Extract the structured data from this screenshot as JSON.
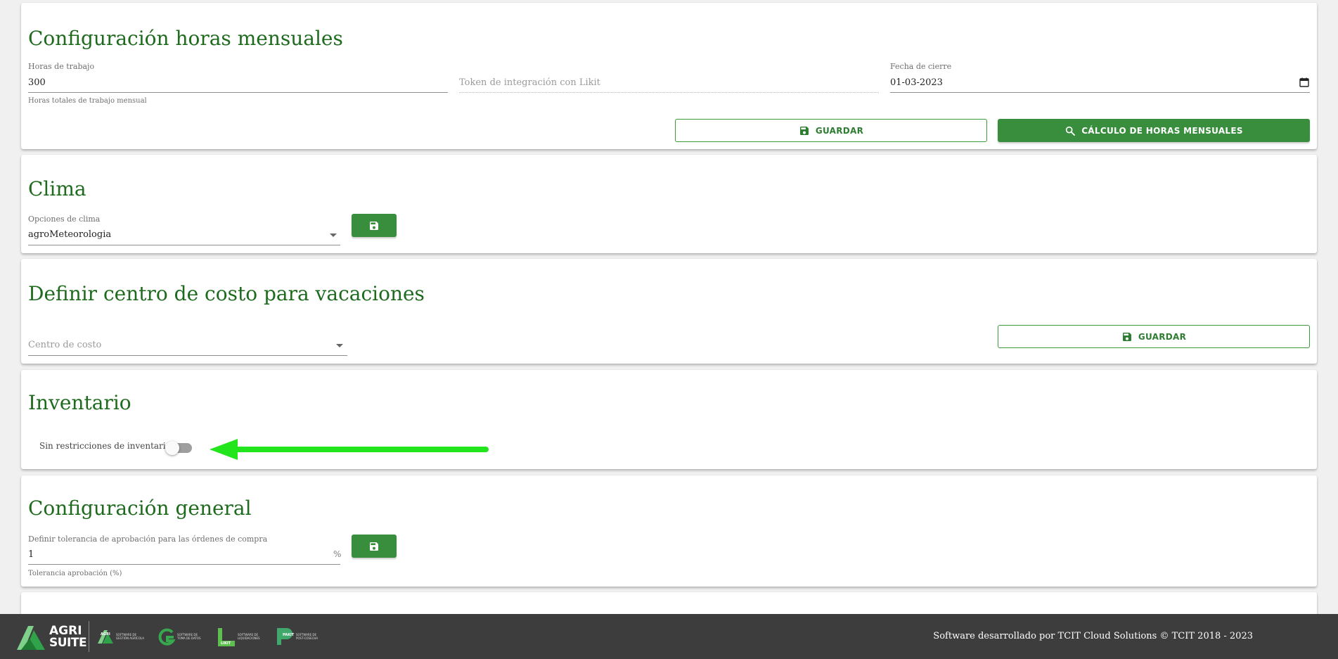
{
  "monthly_hours": {
    "title": "Configuración horas mensuales",
    "work_hours_label": "Horas de trabajo",
    "work_hours_value": "300",
    "work_hours_hint": "Horas totales de trabajo mensual",
    "token_placeholder": "Token de integración con Likit",
    "close_date_label": "Fecha de cierre",
    "close_date_value": "01-03-2023",
    "save_label": "GUARDAR",
    "calc_label": "CÁLCULO DE HORAS MENSUALES"
  },
  "climate": {
    "title": "Clima",
    "options_label": "Opciones de clima",
    "options_value": "agroMeteorologia"
  },
  "cost_center": {
    "title": "Definir centro de costo para vacaciones",
    "placeholder": "Centro de costo",
    "save_label": "GUARDAR"
  },
  "inventory": {
    "title": "Inventario",
    "switch_label": "Sin restricciones de inventario",
    "switch_on": false,
    "arrow_color": "#22e51d"
  },
  "general": {
    "title": "Configuración general",
    "tolerance_label": "Definir tolerancia de aprobación para las órdenes de compra",
    "tolerance_value": "1",
    "tolerance_suffix": "%",
    "tolerance_hint": "Tolerancia aprobación (%)"
  },
  "footer": {
    "brand_top": "AGRI",
    "brand_bottom": "SUITE",
    "logos": [
      {
        "name": "AGRI",
        "caption1": "SOFTWARE DE",
        "caption2": "GESTIÓN AGRÍCOLA"
      },
      {
        "name": "",
        "caption1": "SOFTWARE DE",
        "caption2": "TOMA DE DATOS"
      },
      {
        "name": "LIKIT",
        "caption1": "SOFTWARE DE",
        "caption2": "LIQUIDACIONES"
      },
      {
        "name": "PAKIT",
        "caption1": "SOFTWARE DE",
        "caption2": "POST-COSECHA"
      }
    ],
    "credit": "Software desarrollado por TCIT Cloud Solutions © TCIT 2018 - 2023"
  },
  "colors": {
    "primary": "#388e3c",
    "title_green": "#1e6b1e",
    "footer_bg": "#3d3d3d"
  }
}
